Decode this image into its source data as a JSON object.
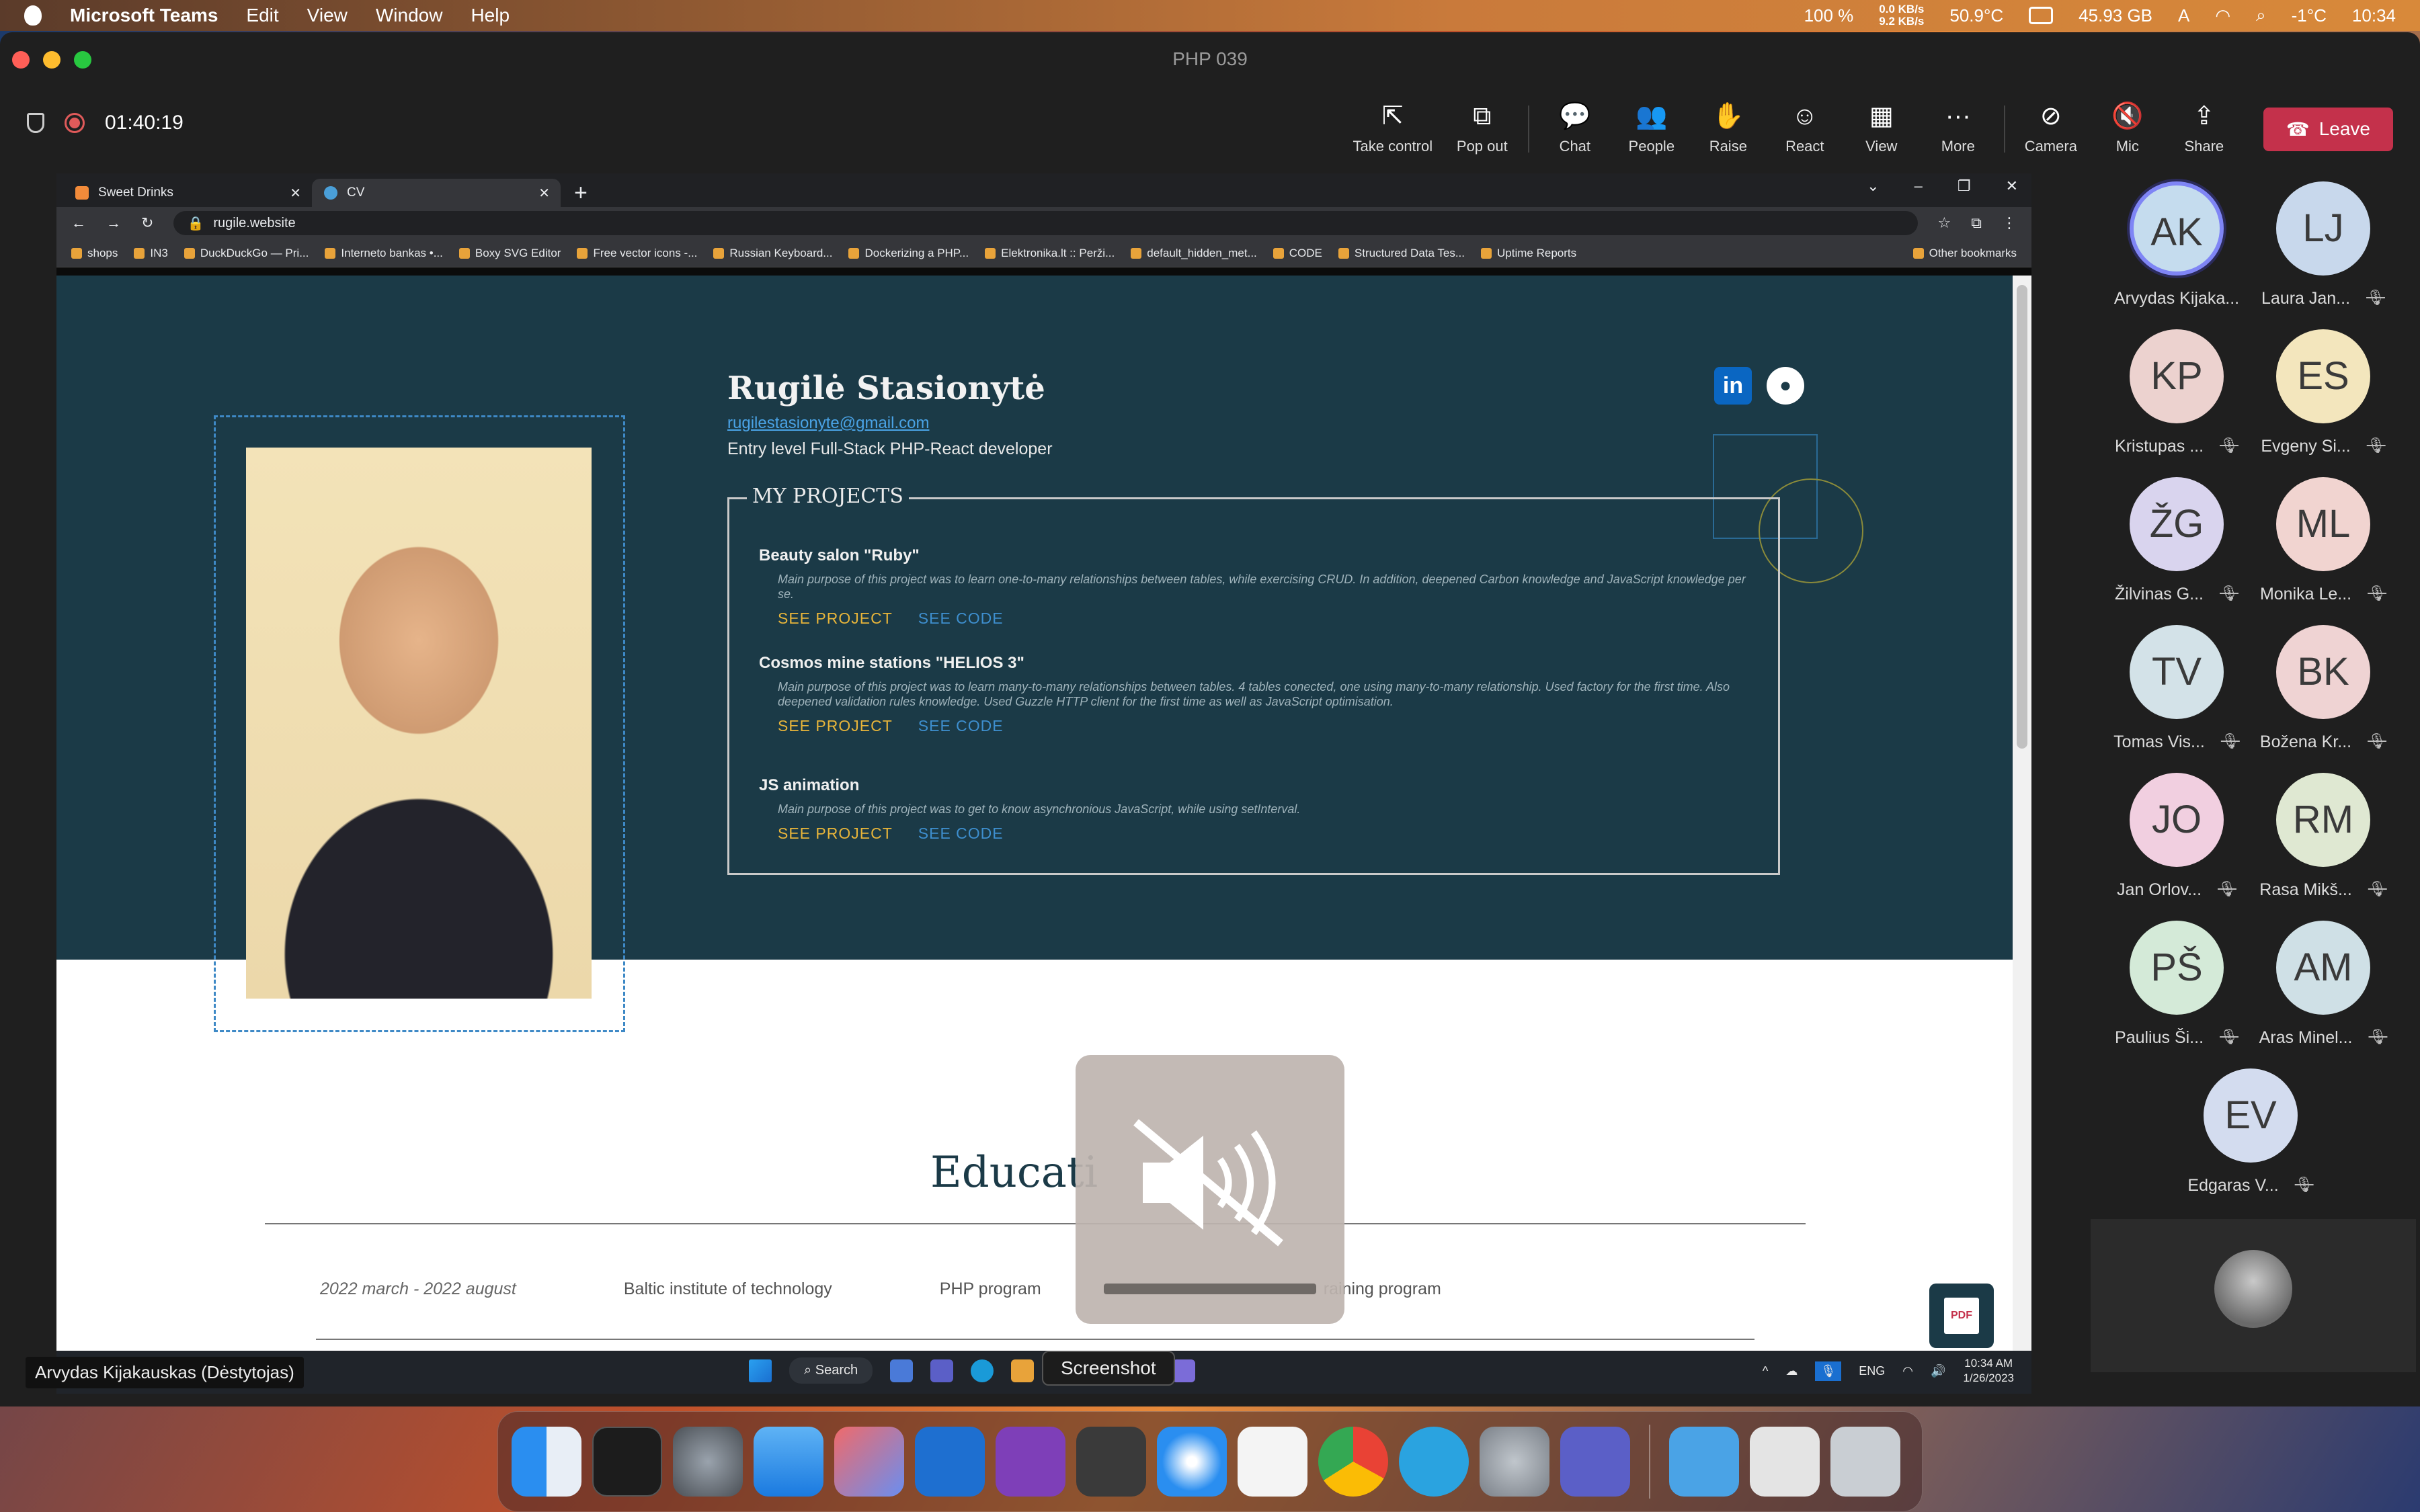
{
  "menubar": {
    "app": "Microsoft Teams",
    "menus": [
      "Edit",
      "View",
      "Window",
      "Help"
    ],
    "status": {
      "battery": "100 %",
      "net_up": "0.0 KB/s",
      "net_down": "9.2 KB/s",
      "temp": "50.9°C",
      "memory": "45.93 GB",
      "input": "A",
      "weather": "-1°C",
      "time": "10:34"
    }
  },
  "teams": {
    "window_title": "PHP 039",
    "timer": "01:40:19",
    "tools": [
      {
        "label": "Take control",
        "icon": "⇱"
      },
      {
        "label": "Pop out",
        "icon": "⧉"
      },
      {
        "label": "Chat",
        "icon": "💬"
      },
      {
        "label": "People",
        "icon": "👥"
      },
      {
        "label": "Raise",
        "icon": "✋"
      },
      {
        "label": "React",
        "icon": "☺"
      },
      {
        "label": "View",
        "icon": "▦"
      },
      {
        "label": "More",
        "icon": "···"
      },
      {
        "label": "Camera",
        "icon": "⊘"
      },
      {
        "label": "Mic",
        "icon": "🔇"
      },
      {
        "label": "Share",
        "icon": "⇪"
      }
    ],
    "leave_label": "Leave",
    "presenter_label": "Arvydas Kijakauskas (Dėstytojas)"
  },
  "browser": {
    "tabs": [
      {
        "title": "Sweet Drinks",
        "active": false
      },
      {
        "title": "CV",
        "active": true
      }
    ],
    "url": "rugile.website",
    "bookmarks": [
      "shops",
      "IN3",
      "DuckDuckGo — Pri...",
      "Interneto bankas •...",
      "Boxy SVG Editor",
      "Free vector icons -...",
      "Russian Keyboard...",
      "Dockerizing a PHP...",
      "Elektronika.lt :: Perži...",
      "default_hidden_met...",
      "CODE",
      "Structured Data Tes...",
      "Uptime Reports"
    ],
    "other_bookmarks": "Other bookmarks"
  },
  "cv": {
    "name": "Rugilė Stasionytė",
    "email": "rugilestasionyte@gmail.com",
    "role": "Entry level Full-Stack PHP-React developer",
    "projects_title": "MY PROJECTS",
    "projects": [
      {
        "title": "Beauty salon \"Ruby\"",
        "desc": "Main purpose of this project was to learn one-to-many relationships between tables, while exercising CRUD. In addition, deepened Carbon knowledge and JavaScript knowledge per se.",
        "see_project": "SEE PROJECT",
        "see_code": "SEE CODE"
      },
      {
        "title": "Cosmos mine stations \"HELIOS 3\"",
        "desc": "Main purpose of this project was to learn many-to-many relationships between tables. 4 tables conected, one using many-to-many relationship. Used factory for the first time. Also deepened validation rules knowledge. Used Guzzle HTTP client for the first time as well as JavaScript optimisation.",
        "see_project": "SEE PROJECT",
        "see_code": "SEE CODE"
      },
      {
        "title": "JS animation",
        "desc": "Main purpose of this project was to get to know asynchronious JavaScript, while using setInterval.",
        "see_project": "SEE PROJECT",
        "see_code": "SEE CODE"
      }
    ],
    "education_title": "Educati",
    "education_row": {
      "date": "2022 march - 2022 august",
      "school": "Baltic institute of technology",
      "program": "PHP program",
      "program_tail": "raining program"
    },
    "pdf_label": "PDF"
  },
  "windows_taskbar": {
    "search": "Search",
    "lang": "ENG",
    "time": "10:34 AM",
    "date": "1/26/2023",
    "weather": "Cloudy"
  },
  "tooltip": "Screenshot",
  "participants": [
    {
      "initials": "AK",
      "name": "Arvydas Kijaka...",
      "color": "#c5dcee",
      "muted": false,
      "selected": true
    },
    {
      "initials": "LJ",
      "name": "Laura Jan...",
      "color": "#c8d8ec",
      "muted": true,
      "selected": false
    },
    {
      "initials": "KP",
      "name": "Kristupas ...",
      "color": "#ecd2cf",
      "muted": true,
      "selected": false
    },
    {
      "initials": "ES",
      "name": "Evgeny Si...",
      "color": "#f3e6bd",
      "muted": true,
      "selected": false
    },
    {
      "initials": "ŽG",
      "name": "Žilvinas G...",
      "color": "#d9d4ee",
      "muted": true,
      "selected": false
    },
    {
      "initials": "ML",
      "name": "Monika Le...",
      "color": "#f1d4d0",
      "muted": true,
      "selected": false
    },
    {
      "initials": "TV",
      "name": "Tomas Vis...",
      "color": "#d3e2e8",
      "muted": true,
      "selected": false
    },
    {
      "initials": "BK",
      "name": "Božena Kr...",
      "color": "#efd3d3",
      "muted": true,
      "selected": false
    },
    {
      "initials": "JO",
      "name": "Jan Orlov...",
      "color": "#f1cfe0",
      "muted": true,
      "selected": false
    },
    {
      "initials": "RM",
      "name": "Rasa Mikš...",
      "color": "#dfe8d2",
      "muted": true,
      "selected": false
    },
    {
      "initials": "PŠ",
      "name": "Paulius Ši...",
      "color": "#d4ead8",
      "muted": true,
      "selected": false
    },
    {
      "initials": "AM",
      "name": "Aras Minel...",
      "color": "#cfe0e6",
      "muted": true,
      "selected": false
    },
    {
      "initials": "EV",
      "name": "Edgaras V...",
      "color": "#d3dcef",
      "muted": true,
      "selected": false
    }
  ],
  "colors": {
    "hero_bg": "#1b3a47",
    "accent_gold": "#e8b53a",
    "accent_blue": "#3e8fcf",
    "leave_red": "#c4314b"
  }
}
